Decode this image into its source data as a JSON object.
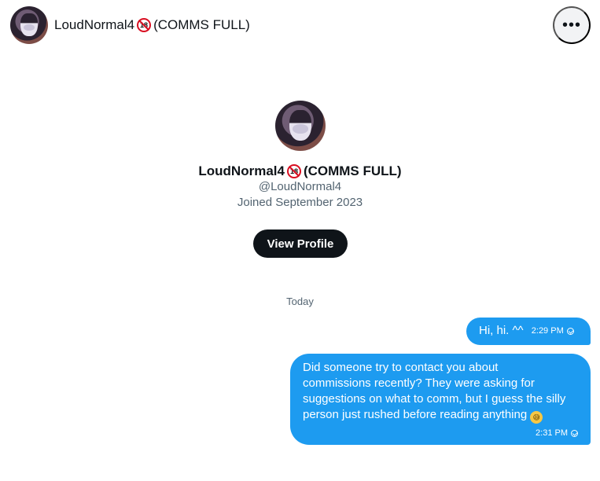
{
  "header": {
    "name": "LoudNormal4",
    "badge": "18",
    "suffix": "(COMMS FULL)",
    "more_icon": "•••"
  },
  "profile": {
    "name": "LoudNormal4",
    "badge": "18",
    "suffix": "(COMMS FULL)",
    "handle": "@LoudNormal4",
    "joined": "Joined September 2023",
    "button_label": "View Profile"
  },
  "conversation": {
    "date_separator": "Today",
    "messages": [
      {
        "text": "Hi, hi. ^^",
        "time": "2:29 PM"
      },
      {
        "text": "Did someone try to contact you about\ncommissions recently? They were asking for\nsuggestions on what to comm, but I guess the silly\nperson just rushed before reading anything",
        "emoji": "😅",
        "time": "2:31 PM"
      }
    ]
  },
  "colors": {
    "accent": "#1d9bf0",
    "dark_button": "#0f1419",
    "secondary_text": "#536471"
  }
}
